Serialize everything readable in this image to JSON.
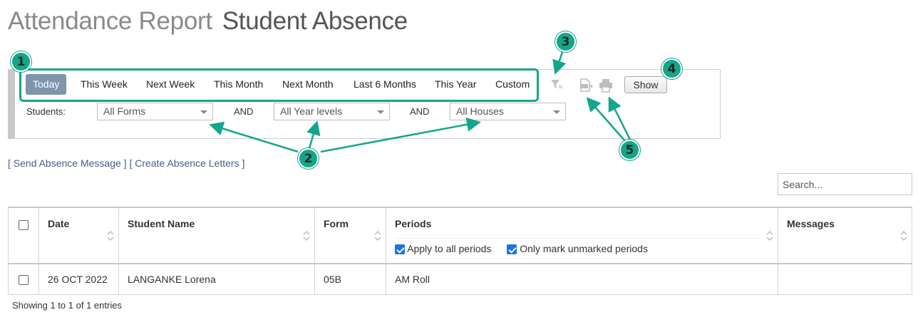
{
  "header": {
    "title": "Attendance Report",
    "subtitle": "Student Absence"
  },
  "date_ranges": [
    "Today",
    "This Week",
    "Next Week",
    "This Month",
    "Next Month",
    "Last 6 Months",
    "This Year",
    "Custom"
  ],
  "filters": {
    "students_label": "Students:",
    "and_label": "AND",
    "form_value": "All Forms",
    "year_value": "All Year levels",
    "house_value": "All Houses"
  },
  "toolbar": {
    "show_label": "Show",
    "filter_icon": "filter-icon",
    "export_icon": "csv-export-icon",
    "print_icon": "print-icon"
  },
  "actions": {
    "send_message": "Send Absence Message",
    "create_letters": "Create Absence Letters",
    "open_bracket": "[",
    "close_bracket": "]"
  },
  "search": {
    "placeholder": "Search..."
  },
  "table": {
    "columns": [
      "Date",
      "Student Name",
      "Form",
      "Periods",
      "Messages"
    ],
    "options": {
      "apply_all": "Apply to all periods",
      "only_unmarked": "Only mark unmarked periods"
    },
    "rows": [
      {
        "date": "26 OCT 2022",
        "student": "LANGANKE Lorena",
        "form": "05B",
        "periods": "AM Roll",
        "messages": ""
      }
    ]
  },
  "footer": {
    "info": "Showing 1 to 1 of 1 entries"
  },
  "callouts": [
    "1",
    "2",
    "3",
    "4",
    "5"
  ],
  "colors": {
    "accent": "#14a68a",
    "active_tab": "#7d95ad",
    "link": "#4a5b8a"
  }
}
